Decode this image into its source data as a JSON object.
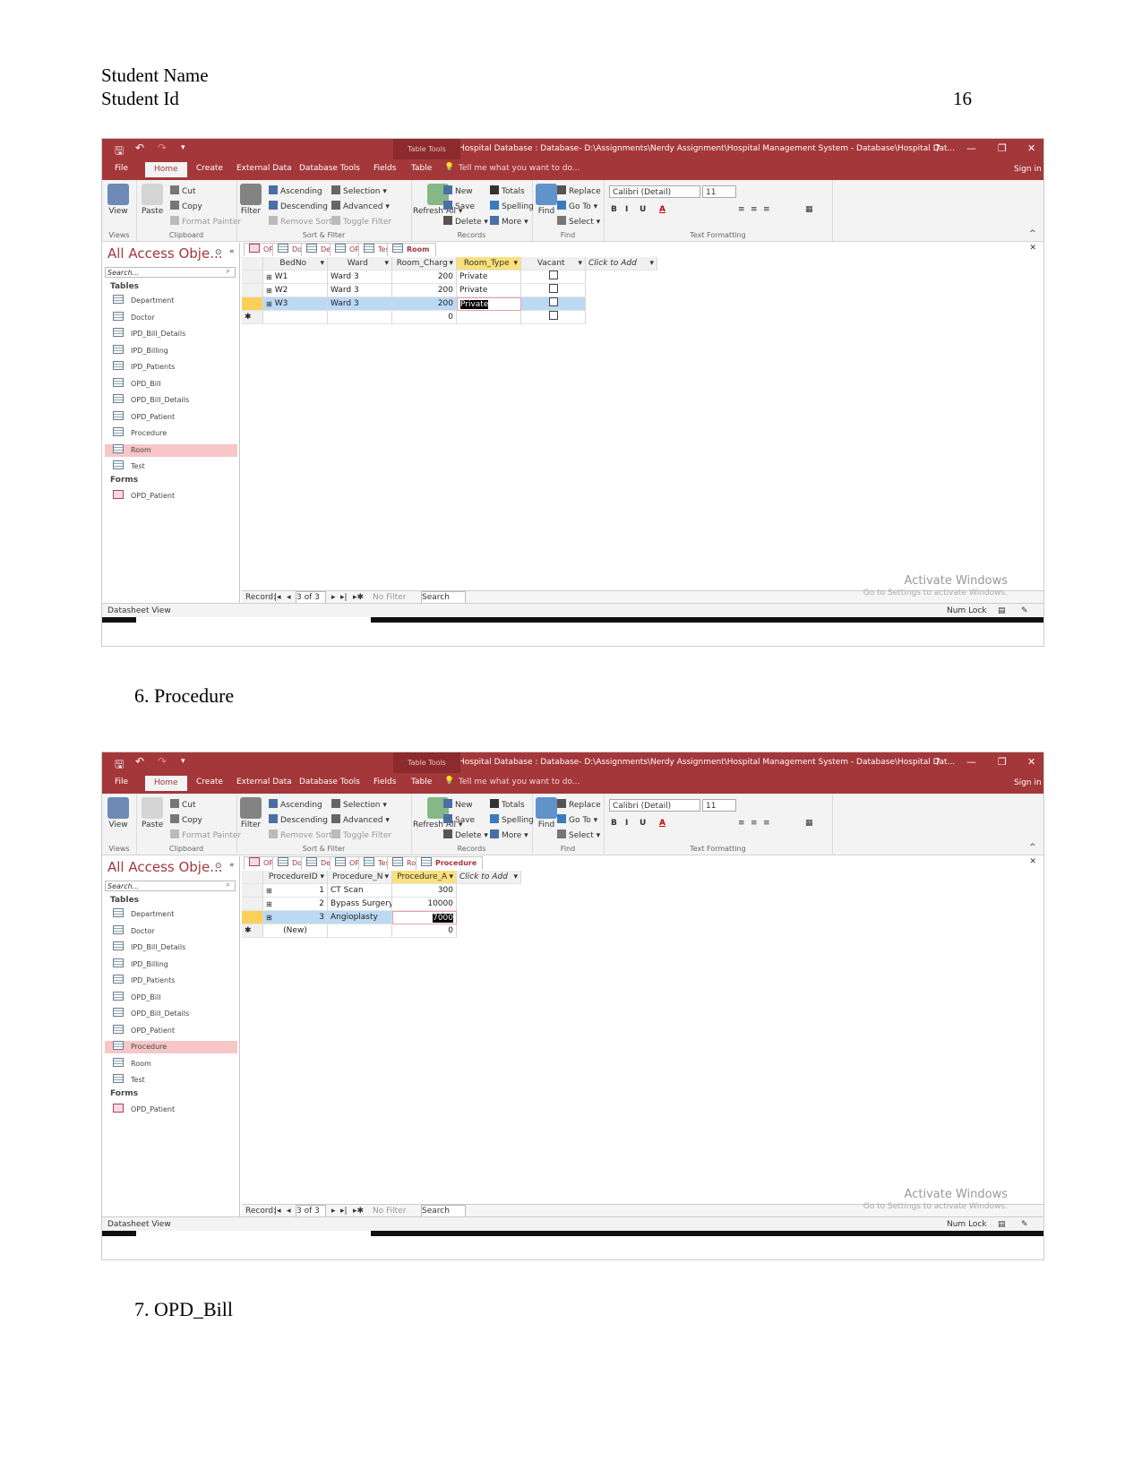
{
  "header": {
    "student_name": "Student Name",
    "student_id": "Student Id",
    "page_number": "16"
  },
  "captions": [
    "6.   Procedure",
    "7.   OPD_Bill"
  ],
  "colors": {
    "access_red": "#a4373a",
    "selected_nav": "#f7c6c7",
    "selected_row": "#bcd9f3",
    "active_header": "#fbe07c"
  },
  "window": {
    "table_tools": "Table Tools",
    "title": "Hospital Database : Database- D:\\Assignments\\Nerdy Assignment\\Hospital Management System - Database\\Hospital Dat...",
    "help": "?",
    "minimize": "—",
    "restore": "❐",
    "close": "✕",
    "tabs": [
      "File",
      "Home",
      "Create",
      "External Data",
      "Database Tools",
      "Fields",
      "Table"
    ],
    "tell_me": "Tell me what you want to do...",
    "sign_in": "Sign in",
    "ribbon": {
      "views": {
        "label": "Views",
        "view": "View"
      },
      "clipboard": {
        "label": "Clipboard",
        "paste": "Paste",
        "cut": "Cut",
        "copy": "Copy",
        "format_painter": "Format Painter"
      },
      "sort_filter": {
        "label": "Sort & Filter",
        "filter": "Filter",
        "ascending": "Ascending",
        "descending": "Descending",
        "remove_sort": "Remove Sort",
        "selection": "Selection ▾",
        "advanced": "Advanced ▾",
        "toggle_filter": "Toggle Filter"
      },
      "records": {
        "label": "Records",
        "refresh": "Refresh All ▾",
        "new": "New",
        "save": "Save",
        "delete": "Delete ▾",
        "totals": "Totals",
        "spelling": "Spelling",
        "more": "More ▾"
      },
      "find": {
        "label": "Find",
        "find": "Find",
        "replace": "Replace",
        "goto": "Go To ▾",
        "select": "Select ▾"
      },
      "text_formatting": {
        "label": "Text Formatting",
        "font": "Calibri (Detail)",
        "size": "11",
        "bold": "B",
        "italic": "I",
        "underline": "U",
        "font_color": "A"
      }
    },
    "nav": {
      "title": "All Access Obje...",
      "search_placeholder": "Search...",
      "tables_label": "Tables",
      "forms_label": "Forms",
      "tables": [
        "Department",
        "Doctor",
        "IPD_Bill_Details",
        "IPD_Billing",
        "IPD_Patients",
        "OPD_Bill",
        "OPD_Bill_Details",
        "OPD_Patient",
        "Procedure",
        "Room",
        "Test"
      ],
      "forms": [
        "OPD_Patient"
      ]
    },
    "record_nav": {
      "label": "Record:",
      "position": "3 of 3",
      "filter": "No Filter",
      "search": "Search"
    },
    "status": {
      "view": "Datasheet View",
      "num_lock": "Num Lock"
    },
    "watermark": {
      "title": "Activate Windows",
      "subtitle": "Go to Settings to activate Windows."
    }
  },
  "screens": [
    {
      "selected_nav": "Room",
      "open_tabs": [
        "OPD_Patient",
        "Doctor",
        "Department",
        "OPD_Patient",
        "Test",
        "Room"
      ],
      "active_tab": "Room",
      "columns": [
        "BedNo",
        "Ward",
        "Room_Charg",
        "Room_Type",
        "Vacant",
        "Click to Add"
      ],
      "highlight_col": "Room_Type",
      "rows": [
        [
          "W1",
          "Ward 3",
          "200",
          "Private",
          false
        ],
        [
          "W2",
          "Ward 3",
          "200",
          "Private",
          false
        ],
        [
          "W3",
          "Ward 3",
          "200",
          "Private",
          false
        ]
      ],
      "new_row": [
        "",
        "",
        "0",
        "",
        false
      ],
      "selected_row": 2
    },
    {
      "selected_nav": "Procedure",
      "open_tabs": [
        "OPD_Patient",
        "Doctor",
        "Department",
        "OPD_Patient",
        "Test",
        "Room",
        "Procedure"
      ],
      "active_tab": "Procedure",
      "columns": [
        "ProcedureID",
        "Procedure_N",
        "Procedure_A",
        "Click to Add"
      ],
      "highlight_col": "Procedure_A",
      "rows": [
        [
          "1",
          "CT Scan",
          "300"
        ],
        [
          "2",
          "Bypass Surgery",
          "10000"
        ],
        [
          "3",
          "Angioplasty",
          "7000"
        ]
      ],
      "new_row": [
        "(New)",
        "",
        "0"
      ],
      "selected_row": 2
    }
  ]
}
